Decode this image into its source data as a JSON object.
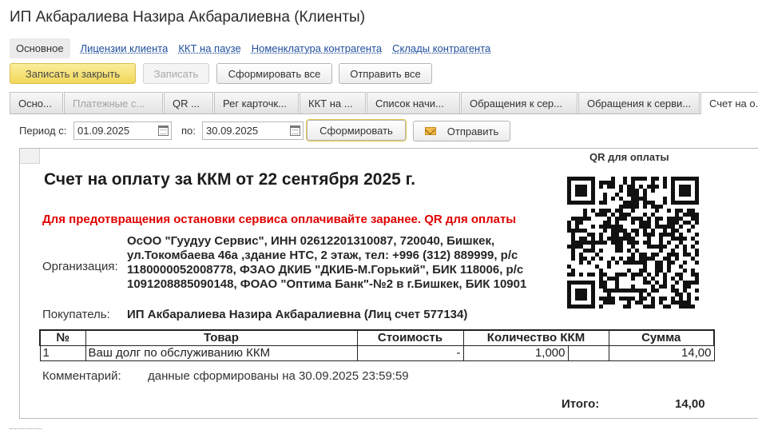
{
  "window": {
    "title": "ИП Акбаралиева Назира Акбаралиевна (Клиенты)"
  },
  "nav": {
    "main": "Основное",
    "links": [
      "Лицензии клиента",
      "ККТ на паузе",
      "Номенклатура контрагента",
      "Склады контрагента"
    ]
  },
  "toolbar": {
    "save_close": "Записать и закрыть",
    "save": "Записать",
    "generate_all": "Сформировать все",
    "send_all": "Отправить все"
  },
  "tabs": [
    "Осно...",
    "Платежные с...",
    "QR ...",
    "Рег карточк...",
    "ККТ на ...",
    "Список начи...",
    "Обращения к сер...",
    "Обращения к серви...",
    "Счет на о..."
  ],
  "period": {
    "from_label": "Период с:",
    "from": "01.09.2025",
    "to_label": "по:",
    "to": "30.09.2025",
    "generate": "Сформировать",
    "send": "Отправить"
  },
  "invoice": {
    "qr_label": "QR для оплаты",
    "title": "Счет на оплату за  ККМ от 22 сентября 2025 г.",
    "warning": "Для предотвращения остановки сервиса оплачивайте заранее. QR для оплаты",
    "org_label": "Организация:",
    "org_lines": [
      "ОсОО \"Гуудуу Сервис\", ИНН 02612201310087, 720040, Бишкек,",
      "ул.Токомбаева 46а ,здание НТС, 2 этаж, тел: +996 (312) 889999, р/с",
      "1180000052008778, ФЗАО ДКИБ \"ДКИБ-М.Горький\", БИК 118006, р/с",
      "1091208885090148, ФОАО \"Оптима Банк\"-№2 в г.Бишкек, БИК 10901"
    ],
    "buyer_label": "Покупатель:",
    "buyer": "ИП Акбаралиева Назира Акбаралиевна (Лиц счет 577134)",
    "columns": [
      "№",
      "Товар",
      "Стоимость",
      "Количество ККМ",
      "Сумма"
    ],
    "rows": [
      {
        "num": "1",
        "item": "Ваш долг по обслуживанию ККМ",
        "price": "-",
        "qty": "1,000",
        "sum": "14,00"
      }
    ],
    "comment_label": "Комментарий:",
    "comment": "данные сформированы на 30.09.2025 23:59:59",
    "total_label": "Итого:",
    "total": "14,00"
  },
  "icons": {
    "calendar": "calendar-icon",
    "envelope": "envelope-icon",
    "qr": "qr-code-icon"
  }
}
